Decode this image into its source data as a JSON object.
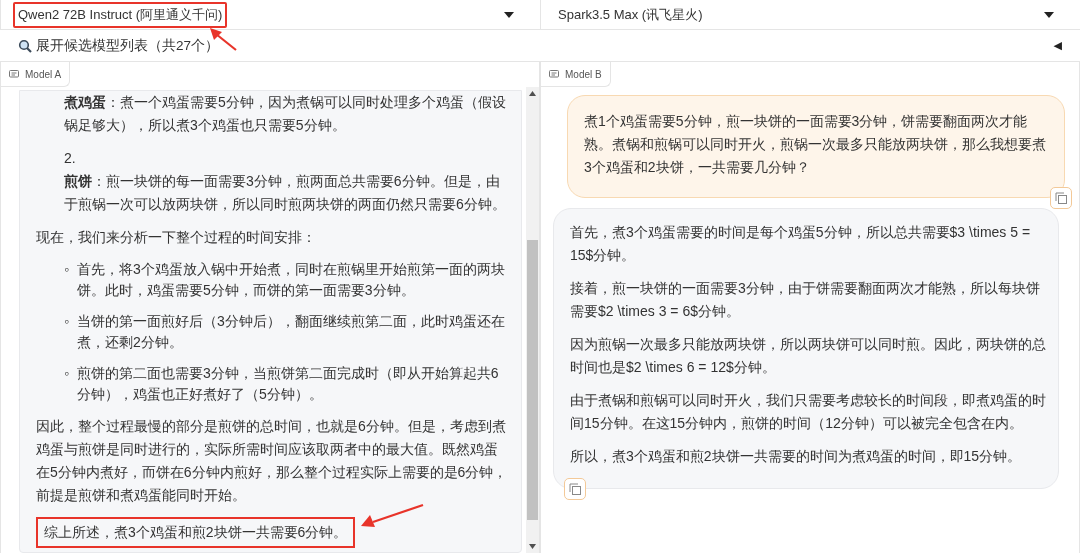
{
  "model_selectors": [
    {
      "value": "Qwen2 72B Instruct (阿里通义千问)",
      "highlighted": true
    },
    {
      "value": "Spark3.5 Max (讯飞星火)",
      "highlighted": false
    }
  ],
  "candidates_toggle": {
    "label": "展开候选模型列表（共27个）",
    "collapse_glyph": "◀"
  },
  "panels": [
    {
      "label": "Model A",
      "messages": [
        {
          "kind": "assistant",
          "copy_button": false,
          "blocks": [
            {
              "kind": "list_text",
              "text": "**煮鸡蛋**：煮一个鸡蛋需要5分钟，因为煮锅可以同时处理多个鸡蛋（假设锅足够大），所以煮3个鸡蛋也只需要5分钟。"
            },
            {
              "kind": "numbered_item",
              "marker": "2.",
              "text": "**煎饼**：煎一块饼的每一面需要3分钟，煎两面总共需要6分钟。但是，由于煎锅一次可以放两块饼，所以同时煎两块饼的两面仍然只需要6分钟。"
            },
            {
              "kind": "paragraph",
              "text": "现在，我们来分析一下整个过程的时间安排：",
              "highlighted": false
            },
            {
              "kind": "bullet",
              "marker": "◦",
              "text": "首先，将3个鸡蛋放入锅中开始煮，同时在煎锅里开始煎第一面的两块饼。此时，鸡蛋需要5分钟，而饼的第一面需要3分钟。"
            },
            {
              "kind": "bullet",
              "marker": "◦",
              "text": "当饼的第一面煎好后（3分钟后），翻面继续煎第二面，此时鸡蛋还在煮，还剩2分钟。"
            },
            {
              "kind": "bullet",
              "marker": "◦",
              "text": "煎饼的第二面也需要3分钟，当煎饼第二面完成时（即从开始算起共6分钟），鸡蛋也正好煮好了（5分钟）。"
            },
            {
              "kind": "paragraph",
              "text": "因此，整个过程最慢的部分是煎饼的总时间，也就是6分钟。但是，考虑到煮鸡蛋与煎饼是同时进行的，实际所需时间应该取两者中的最大值。既然鸡蛋在5分钟内煮好，而饼在6分钟内煎好，那么整个过程实际上需要的是6分钟，前提是煎饼和煮鸡蛋能同时开始。",
              "highlighted": false
            },
            {
              "kind": "paragraph",
              "text": "综上所述，煮3个鸡蛋和煎2块饼一共需要6分钟。",
              "highlighted": true
            }
          ]
        }
      ]
    },
    {
      "label": "Model B",
      "messages": [
        {
          "kind": "user",
          "copy_button": true,
          "blocks": [
            {
              "kind": "paragraph",
              "text": "煮1个鸡蛋需要5分钟，煎一块饼的一面需要3分钟，饼需要翻面两次才能熟。煮锅和煎锅可以同时开火，煎锅一次最多只能放两块饼，那么我想要煮3个鸡蛋和2块饼，一共需要几分钟？",
              "highlighted": false
            }
          ]
        },
        {
          "kind": "assistant",
          "copy_button": true,
          "blocks": [
            {
              "kind": "paragraph",
              "text": "首先，煮3个鸡蛋需要的时间是每个鸡蛋5分钟，所以总共需要$3 \\times 5 = 15$分钟。",
              "highlighted": false
            },
            {
              "kind": "paragraph",
              "text": "接着，煎一块饼的一面需要3分钟，由于饼需要翻面两次才能熟，所以每块饼需要$2 \\times 3 = 6$分钟。",
              "highlighted": false
            },
            {
              "kind": "paragraph",
              "text": "因为煎锅一次最多只能放两块饼，所以两块饼可以同时煎。因此，两块饼的总时间也是$2 \\times 6 = 12$分钟。",
              "highlighted": false
            },
            {
              "kind": "paragraph",
              "text": "由于煮锅和煎锅可以同时开火，我们只需要考虑较长的时间段，即煮鸡蛋的时间15分钟。在这15分钟内，煎饼的时间（12分钟）可以被完全包含在内。",
              "highlighted": false
            },
            {
              "kind": "paragraph",
              "text": "所以，煮3个鸡蛋和煎2块饼一共需要的时间为煮鸡蛋的时间，即15分钟。",
              "highlighted": false
            }
          ]
        }
      ]
    }
  ]
}
